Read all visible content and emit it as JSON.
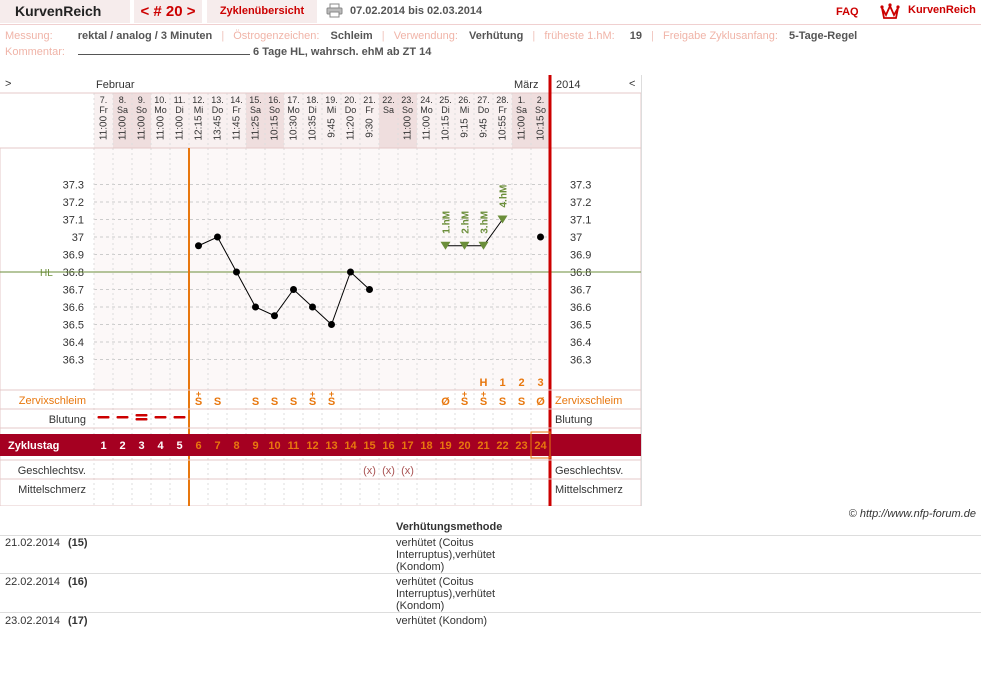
{
  "topbar": {
    "app_title": "KurvenReich",
    "cycle_nav": "< # 20 >",
    "overview_tab": "Zyklenübersicht",
    "print_icon": "printer-icon",
    "date_range": "07.02.2014 bis 02.03.2014",
    "faq": "FAQ",
    "logo_text": "KurvenReich",
    "logo_icon": "crown-logo-icon"
  },
  "info": {
    "messung_label": "Messung:",
    "messung_value": "rektal / analog / 3 Minuten",
    "oestrogen_label": "Östrogenzeichen:",
    "oestrogen_value": "Schleim",
    "verwendung_label": "Verwendung:",
    "verwendung_value": "Verhütung",
    "hm_label": "früheste 1.hM:",
    "hm_value": "19",
    "freigabe_label": "Freigabe Zyklusanfang:",
    "freigabe_value": "5-Tage-Regel",
    "kommentar_label": "Kommentar:",
    "kommentar_value": "6 Tage HL, wahrsch. ehM ab ZT 14"
  },
  "chart_data": {
    "type": "line",
    "month_left": "Februar",
    "month_right": "März",
    "year": "2014",
    "nav_left": ">",
    "nav_right": "<",
    "days": [
      {
        "d": "7.",
        "wd": "Fr",
        "t": "11:00"
      },
      {
        "d": "8.",
        "wd": "Sa",
        "t": "11:00"
      },
      {
        "d": "9.",
        "wd": "So",
        "t": "11:00"
      },
      {
        "d": "10.",
        "wd": "Mo",
        "t": "11:00"
      },
      {
        "d": "11.",
        "wd": "Di",
        "t": "11:00"
      },
      {
        "d": "12.",
        "wd": "Mi",
        "t": "12:15"
      },
      {
        "d": "13.",
        "wd": "Do",
        "t": "13:45"
      },
      {
        "d": "14.",
        "wd": "Fr",
        "t": "11:45"
      },
      {
        "d": "15.",
        "wd": "Sa",
        "t": "11:25"
      },
      {
        "d": "16.",
        "wd": "So",
        "t": "10:15"
      },
      {
        "d": "17.",
        "wd": "Mo",
        "t": "10:30"
      },
      {
        "d": "18.",
        "wd": "Di",
        "t": "10:35"
      },
      {
        "d": "19.",
        "wd": "Mi",
        "t": "9:45"
      },
      {
        "d": "20.",
        "wd": "Do",
        "t": "11:20"
      },
      {
        "d": "21.",
        "wd": "Fr",
        "t": "9:30"
      },
      {
        "d": "22.",
        "wd": "Sa",
        "t": ""
      },
      {
        "d": "23.",
        "wd": "So",
        "t": "11:00"
      },
      {
        "d": "24.",
        "wd": "Mo",
        "t": "11:00"
      },
      {
        "d": "25.",
        "wd": "Di",
        "t": "10:15"
      },
      {
        "d": "26.",
        "wd": "Mi",
        "t": "9:15"
      },
      {
        "d": "27.",
        "wd": "Do",
        "t": "9:45"
      },
      {
        "d": "28.",
        "wd": "Fr",
        "t": "10:55"
      },
      {
        "d": "1.",
        "wd": "Sa",
        "t": "11:00"
      },
      {
        "d": "2.",
        "wd": "So",
        "t": "10:15"
      }
    ],
    "yticks": [
      "37.3",
      "37.2",
      "37.1",
      "37",
      "36.9",
      "36.8",
      "36.7",
      "36.6",
      "36.5",
      "36.4",
      "36.3"
    ],
    "ylim": [
      36.2,
      37.4
    ],
    "coverline_label": "HL",
    "coverline_value": 36.8,
    "temperatures": [
      null,
      null,
      null,
      null,
      null,
      36.95,
      37.0,
      36.8,
      36.6,
      36.55,
      36.7,
      36.6,
      36.5,
      36.8,
      36.7,
      null,
      null,
      null,
      36.95,
      36.95,
      36.95,
      37.1,
      null,
      37.0
    ],
    "hm_markers": [
      {
        "day": 19,
        "label": "1.hM"
      },
      {
        "day": 20,
        "label": "2.hM"
      },
      {
        "day": 21,
        "label": "3.hM"
      },
      {
        "day": 22,
        "label": "4.hM"
      }
    ],
    "peak_labels": [
      {
        "day": 21,
        "label": "H"
      },
      {
        "day": 22,
        "label": "1"
      },
      {
        "day": 23,
        "label": "2"
      },
      {
        "day": 24,
        "label": "3"
      }
    ],
    "mucus_label": "Zervixschleim",
    "mucus": [
      "",
      "",
      "",
      "",
      "",
      "S+",
      "S",
      "",
      "S",
      "S",
      "S",
      "S+",
      "S+",
      "",
      "",
      "",
      "",
      "",
      "Ø",
      "S+",
      "S+",
      "S",
      "S",
      "Ø"
    ],
    "bleeding_label": "Blutung",
    "bleeding": [
      1,
      1,
      2,
      1,
      1,
      0,
      0,
      0,
      0,
      0,
      0,
      0,
      0,
      0,
      0,
      0,
      0,
      0,
      0,
      0,
      0,
      0,
      0,
      0
    ],
    "cycle_day_label": "Zyklustag",
    "cycle_days": [
      "1",
      "2",
      "3",
      "4",
      "5",
      "6",
      "7",
      "8",
      "9",
      "10",
      "11",
      "12",
      "13",
      "14",
      "15",
      "16",
      "17",
      "18",
      "19",
      "20",
      "21",
      "22",
      "23",
      "24"
    ],
    "intercourse_label": "Geschlechtsv.",
    "intercourse": [
      "",
      "",
      "",
      "",
      "",
      "",
      "",
      "",
      "",
      "",
      "",
      "",
      "",
      "",
      "(x)",
      "(x)",
      "(x)",
      "",
      "",
      "",
      "",
      "",
      "",
      ""
    ],
    "mittelschmerz_label": "Mittelschmerz"
  },
  "copyright": "© http://www.nfp-forum.de",
  "table": {
    "header": "Verhütungsmethode",
    "rows": [
      {
        "date": "21.02.2014",
        "day": "(15)",
        "method": "verhütet (Coitus Interruptus),verhütet (Kondom)"
      },
      {
        "date": "22.02.2014",
        "day": "(16)",
        "method": "verhütet (Coitus Interruptus),verhütet (Kondom)"
      },
      {
        "date": "23.02.2014",
        "day": "(17)",
        "method": "verhütet (Kondom)"
      }
    ]
  },
  "colors": {
    "accent": "#cc0000",
    "dark_red": "#a50021",
    "orange": "#e8770e",
    "green": "#6b8e3a",
    "pink_bg": "#f6ecec"
  }
}
